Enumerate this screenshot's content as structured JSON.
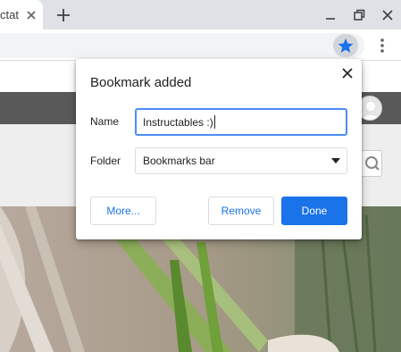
{
  "tab": {
    "title": "ctat"
  },
  "dialog": {
    "title": "Bookmark added",
    "name_label": "Name",
    "name_value": "Instructables :)",
    "folder_label": "Folder",
    "folder_value": "Bookmarks bar",
    "buttons": {
      "more": "More...",
      "remove": "Remove",
      "done": "Done"
    }
  },
  "colors": {
    "accent": "#1a73e8",
    "focus_ring": "#4c8df6",
    "page_nav": "#595959"
  },
  "icons": [
    "close-icon",
    "plus-icon",
    "minimize-icon",
    "restore-icon",
    "star-icon",
    "more-vert-icon",
    "search-icon",
    "avatar-icon",
    "chevron-down-icon"
  ]
}
